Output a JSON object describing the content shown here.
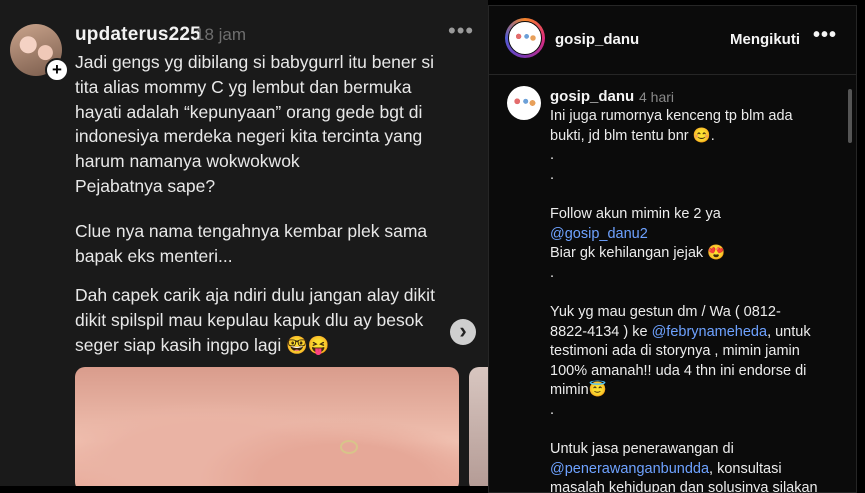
{
  "post": {
    "username": "updaterus225",
    "time": "18 jam",
    "more": "•••",
    "plus": "+",
    "paragraphs": [
      "Jadi gengs yg dibilang si babygurrl itu bener si\ntita alias mommy C yg lembut dan bermuka\nhayati adalah “kepunyaan” orang gede bgt di\nindonesiya merdeka negeri kita tercinta yang\nharum namanya wokwokwok\nPejabatnya sape?",
      "Clue nya nama tengahnya kembar plek sama\nbapak eks menteri...",
      "Dah capek carik aja ndiri dulu jangan alay dikit\ndikit spilspil mau kepulau kapuk dlu ay besok\nseger siap kasih ingpo lagi 🤓😝"
    ],
    "next": "›"
  },
  "panel": {
    "username": "gosip_danu",
    "follow": "Mengikuti",
    "more": "•••",
    "caption": {
      "username": "gosip_danu",
      "time": "4 hari",
      "lines": [
        {
          "text": "Ini juga rumornya kenceng tp blm ada"
        },
        {
          "text": "bukti, jd blm tentu bnr 😊."
        },
        {
          "text": "."
        },
        {
          "text": "."
        },
        {
          "text": ""
        },
        {
          "text": "Follow akun mimin ke 2 ya"
        },
        {
          "mention": "@gosip_danu2"
        },
        {
          "text": "Biar gk kehilangan jejak 😍"
        },
        {
          "text": "."
        },
        {
          "text": ""
        },
        {
          "text": "Yuk yg mau gestun dm / Wa ( 0812-"
        },
        {
          "text": "8822-4134 ) ke ",
          "mention": "@febrynameheda",
          "after": ", untuk"
        },
        {
          "text": "testimoni ada di storynya , mimin jamin"
        },
        {
          "text": "100% amanah!! uda 4 thn ini endorse di"
        },
        {
          "text": "mimin😇"
        },
        {
          "text": "."
        },
        {
          "text": ""
        },
        {
          "text": "Untuk jasa penerawangan di"
        },
        {
          "mention": "@penerawanganbundda",
          "after": ", konsultasi"
        },
        {
          "text": "masalah kehidupan dan solusinya silakan"
        }
      ]
    }
  },
  "colors": {
    "mention": "#6ea2ff",
    "background": "#1a1a1a",
    "panel": "#0b0b0b"
  }
}
